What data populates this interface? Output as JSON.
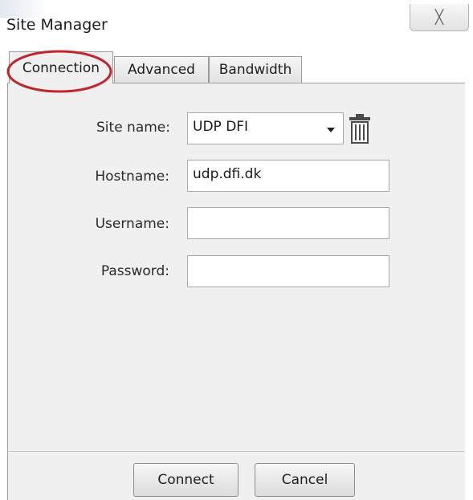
{
  "window": {
    "title": "Site Manager",
    "close_glyph": "╳"
  },
  "tabs": [
    {
      "label": "Connection",
      "active": true
    },
    {
      "label": "Advanced",
      "active": false
    },
    {
      "label": "Bandwidth",
      "active": false
    }
  ],
  "form": {
    "site_name": {
      "label": "Site name:",
      "value": "UDP DFI"
    },
    "hostname": {
      "label": "Hostname:",
      "value": "udp.dfi.dk"
    },
    "username": {
      "label": "Username:",
      "value": ""
    },
    "password": {
      "label": "Password:",
      "value": ""
    }
  },
  "buttons": {
    "connect": "Connect",
    "cancel": "Cancel"
  },
  "icons": {
    "delete": "trash-icon",
    "close": "close-icon",
    "dropdown": "chevron-down-icon"
  },
  "colors": {
    "annotation": "#c0262c",
    "panel": "#f0f0f0"
  }
}
